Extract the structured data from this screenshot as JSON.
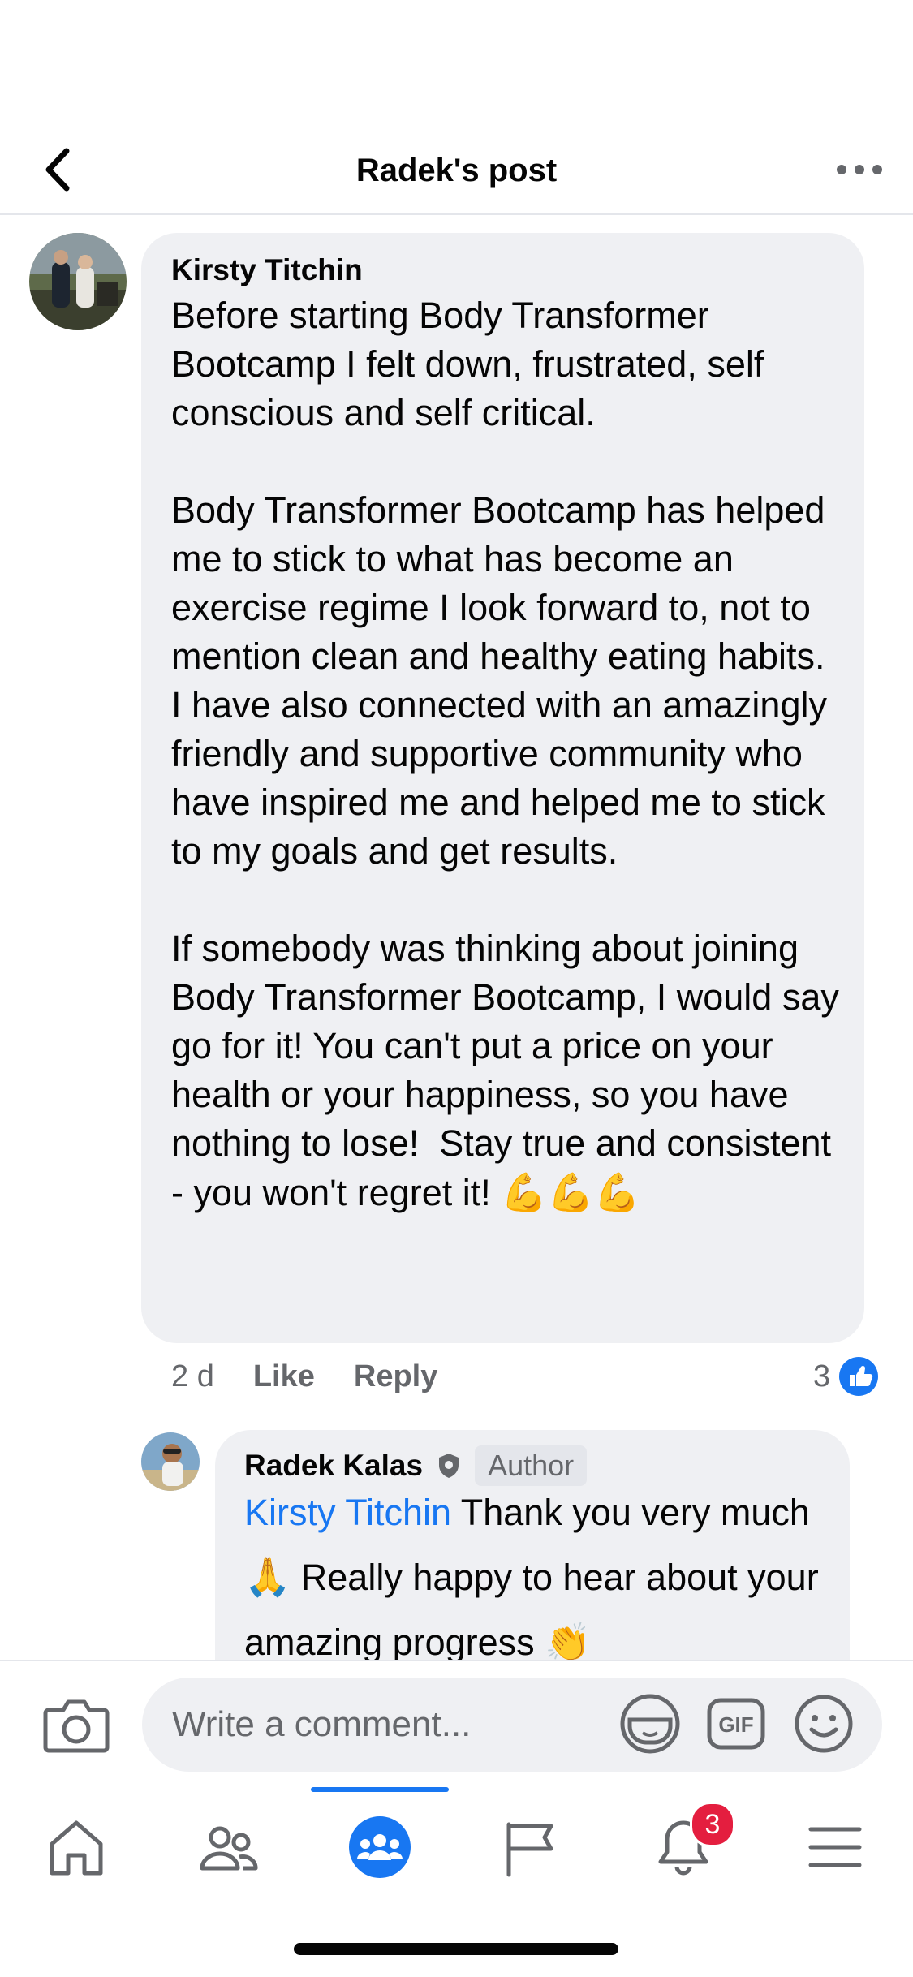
{
  "header": {
    "title": "Radek's post"
  },
  "comments": [
    {
      "author": "Kirsty Titchin",
      "text": "Before starting Body Transformer Bootcamp I felt down, frustrated, self conscious and self critical.\n\nBody Transformer Bootcamp has helped me to stick to what has become an exercise regime I look forward to, not to mention clean and healthy eating habits. I have also connected with an amazingly friendly and supportive community who have inspired me and helped me to stick to my goals and get results.\n\nIf somebody was thinking about joining Body Transformer Bootcamp, I would say go for it! You can't put a price on your health or your happiness, so you have nothing to lose!  Stay true and consistent - you won't regret it! ",
      "emoji": "💪💪💪",
      "time": "2 d",
      "like_label": "Like",
      "reply_label": "Reply",
      "reaction_count": "3"
    }
  ],
  "reply": {
    "author": "Radek Kalas",
    "badge": "Author",
    "mention": "Kirsty Titchin",
    "text_1": " Thank you very much ",
    "emoji_1": "🙏",
    "text_2": " Really happy to hear about your amazing progress ",
    "emoji_2": "👏"
  },
  "composer": {
    "placeholder": "Write a comment..."
  },
  "tabs": [
    {
      "name": "home",
      "icon": "home-icon"
    },
    {
      "name": "friends",
      "icon": "friends-icon"
    },
    {
      "name": "groups",
      "icon": "groups-icon",
      "active": true
    },
    {
      "name": "pages",
      "icon": "flag-icon"
    },
    {
      "name": "notifications",
      "icon": "bell-icon",
      "badge": "3"
    },
    {
      "name": "menu",
      "icon": "hamburger-icon"
    }
  ],
  "colors": {
    "accent": "#1877f2",
    "bubble": "#eff0f3",
    "badge": "#e41e3f",
    "meta": "#65676b"
  }
}
